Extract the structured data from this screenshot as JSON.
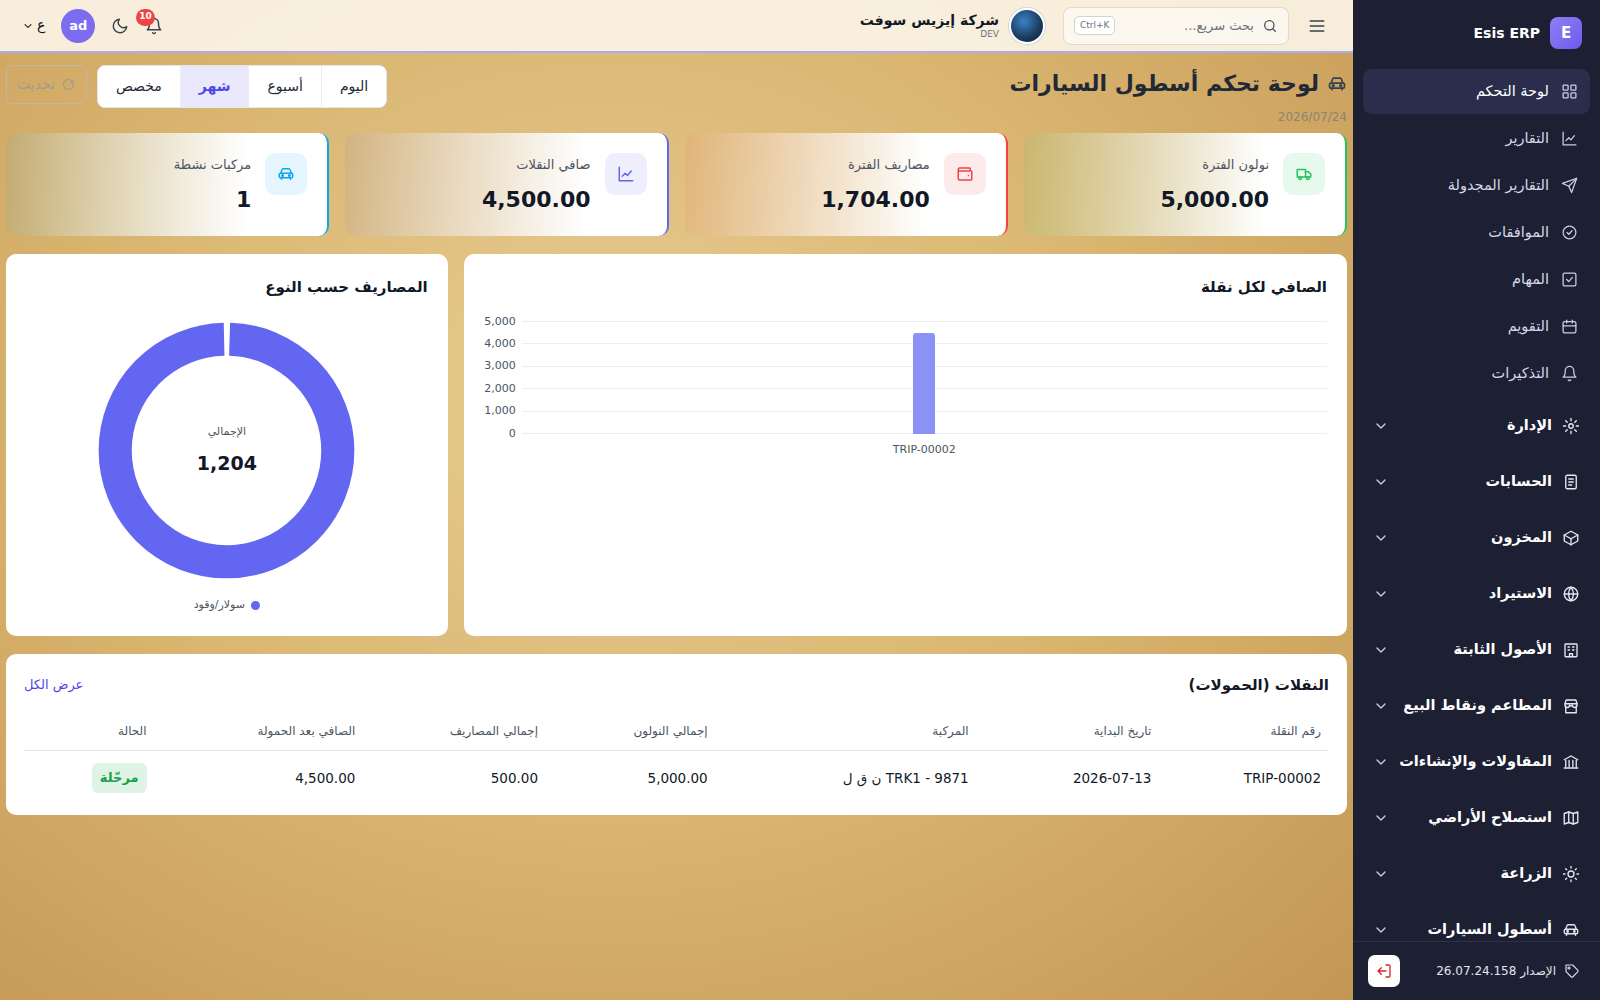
{
  "sidebar": {
    "logo": "E",
    "brand": "Esis ERP",
    "items": [
      {
        "label": "لوحة التحكم",
        "kind": "link",
        "selected": true
      },
      {
        "label": "التقارير",
        "kind": "link",
        "selected": false
      },
      {
        "label": "التقارير المجدولة",
        "kind": "link",
        "selected": false
      },
      {
        "label": "الموافقات",
        "kind": "link",
        "selected": false
      },
      {
        "label": "المهام",
        "kind": "link",
        "selected": false
      },
      {
        "label": "التقويم",
        "kind": "link",
        "selected": false
      },
      {
        "label": "التذكيرات",
        "kind": "link",
        "selected": false
      },
      {
        "label": "الإدارة",
        "kind": "group",
        "selected": false,
        "expanded": false
      },
      {
        "label": "الحسابات",
        "kind": "group",
        "selected": false,
        "expanded": false
      },
      {
        "label": "المخزون",
        "kind": "group",
        "selected": false,
        "expanded": false
      },
      {
        "label": "الاستيراد",
        "kind": "group",
        "selected": false,
        "expanded": false
      },
      {
        "label": "الأصول الثابتة",
        "kind": "group",
        "selected": false,
        "expanded": false
      },
      {
        "label": "المطاعم ونقاط البيع",
        "kind": "group",
        "selected": false,
        "expanded": false
      },
      {
        "label": "المقاولات والإنشاءات",
        "kind": "group",
        "selected": false,
        "expanded": false
      },
      {
        "label": "استصلاح الأراضي",
        "kind": "group",
        "selected": false,
        "expanded": false
      },
      {
        "label": "الزراعة",
        "kind": "group",
        "selected": false,
        "expanded": false
      },
      {
        "label": "أسطول السيارات",
        "kind": "group",
        "selected": false,
        "expanded": false
      }
    ],
    "version": "الإصدار 26.07.24.158"
  },
  "topbar": {
    "search": {
      "placeholder": "بحث سريع...",
      "shortcut": "Ctrl+K"
    },
    "company": {
      "name": "شركة إيزيس سوفت",
      "env": "DEV"
    },
    "notifications": "10",
    "user": "ad",
    "language": "ع"
  },
  "page": {
    "title": "لوحة تحكم أسطول السيارات",
    "date": "2026/07/24"
  },
  "periods": [
    {
      "label": "اليوم",
      "selected": false
    },
    {
      "label": "أسبوع",
      "selected": false
    },
    {
      "label": "شهر",
      "selected": true
    },
    {
      "label": "مخصص",
      "selected": false
    }
  ],
  "refresh": {
    "label": "تحديث",
    "disabled": true
  },
  "stats": [
    {
      "label": "نولون الفترة",
      "value": "5,000.00",
      "color": "#22c55e"
    },
    {
      "label": "مصاريف الفترة",
      "value": "1,704.00",
      "color": "#ef4444"
    },
    {
      "label": "صافي النقلات",
      "value": "4,500.00",
      "color": "#6366f1"
    },
    {
      "label": "مركبات نشطة",
      "value": "1",
      "color": "#0ea5e9"
    }
  ],
  "net_chart": {
    "title": "الصافي لكل نقلة",
    "ticks": [
      "0",
      "1,000",
      "2,000",
      "3,000",
      "4,000",
      "5,000"
    ],
    "categories": [
      "TRIP-00002"
    ],
    "values": [
      4500
    ]
  },
  "expense_chart": {
    "title": "المصاريف حسب النوع",
    "center_label": "الإجمالي",
    "center_value": "1,204",
    "segments": [
      {
        "label": "سولار/وقود",
        "value": 1204,
        "color": "#6366f1"
      }
    ]
  },
  "trips": {
    "title": "النقلات (الحمولات)",
    "view_all": "عرض الكل",
    "columns": [
      "رقم النقلة",
      "تاريخ البداية",
      "المركبة",
      "إجمالي النولون",
      "إجمالي المصاريف",
      "الصافي بعد الحمولة",
      "الحالة"
    ],
    "rows": [
      {
        "cells": [
          "TRIP-00002",
          "2026-07-13",
          "TRK1 - 9871 ن ق ل",
          "5,000.00",
          "500.00",
          "4,500.00",
          "مرحّلة"
        ],
        "status_color": "#16a34a"
      }
    ]
  }
}
